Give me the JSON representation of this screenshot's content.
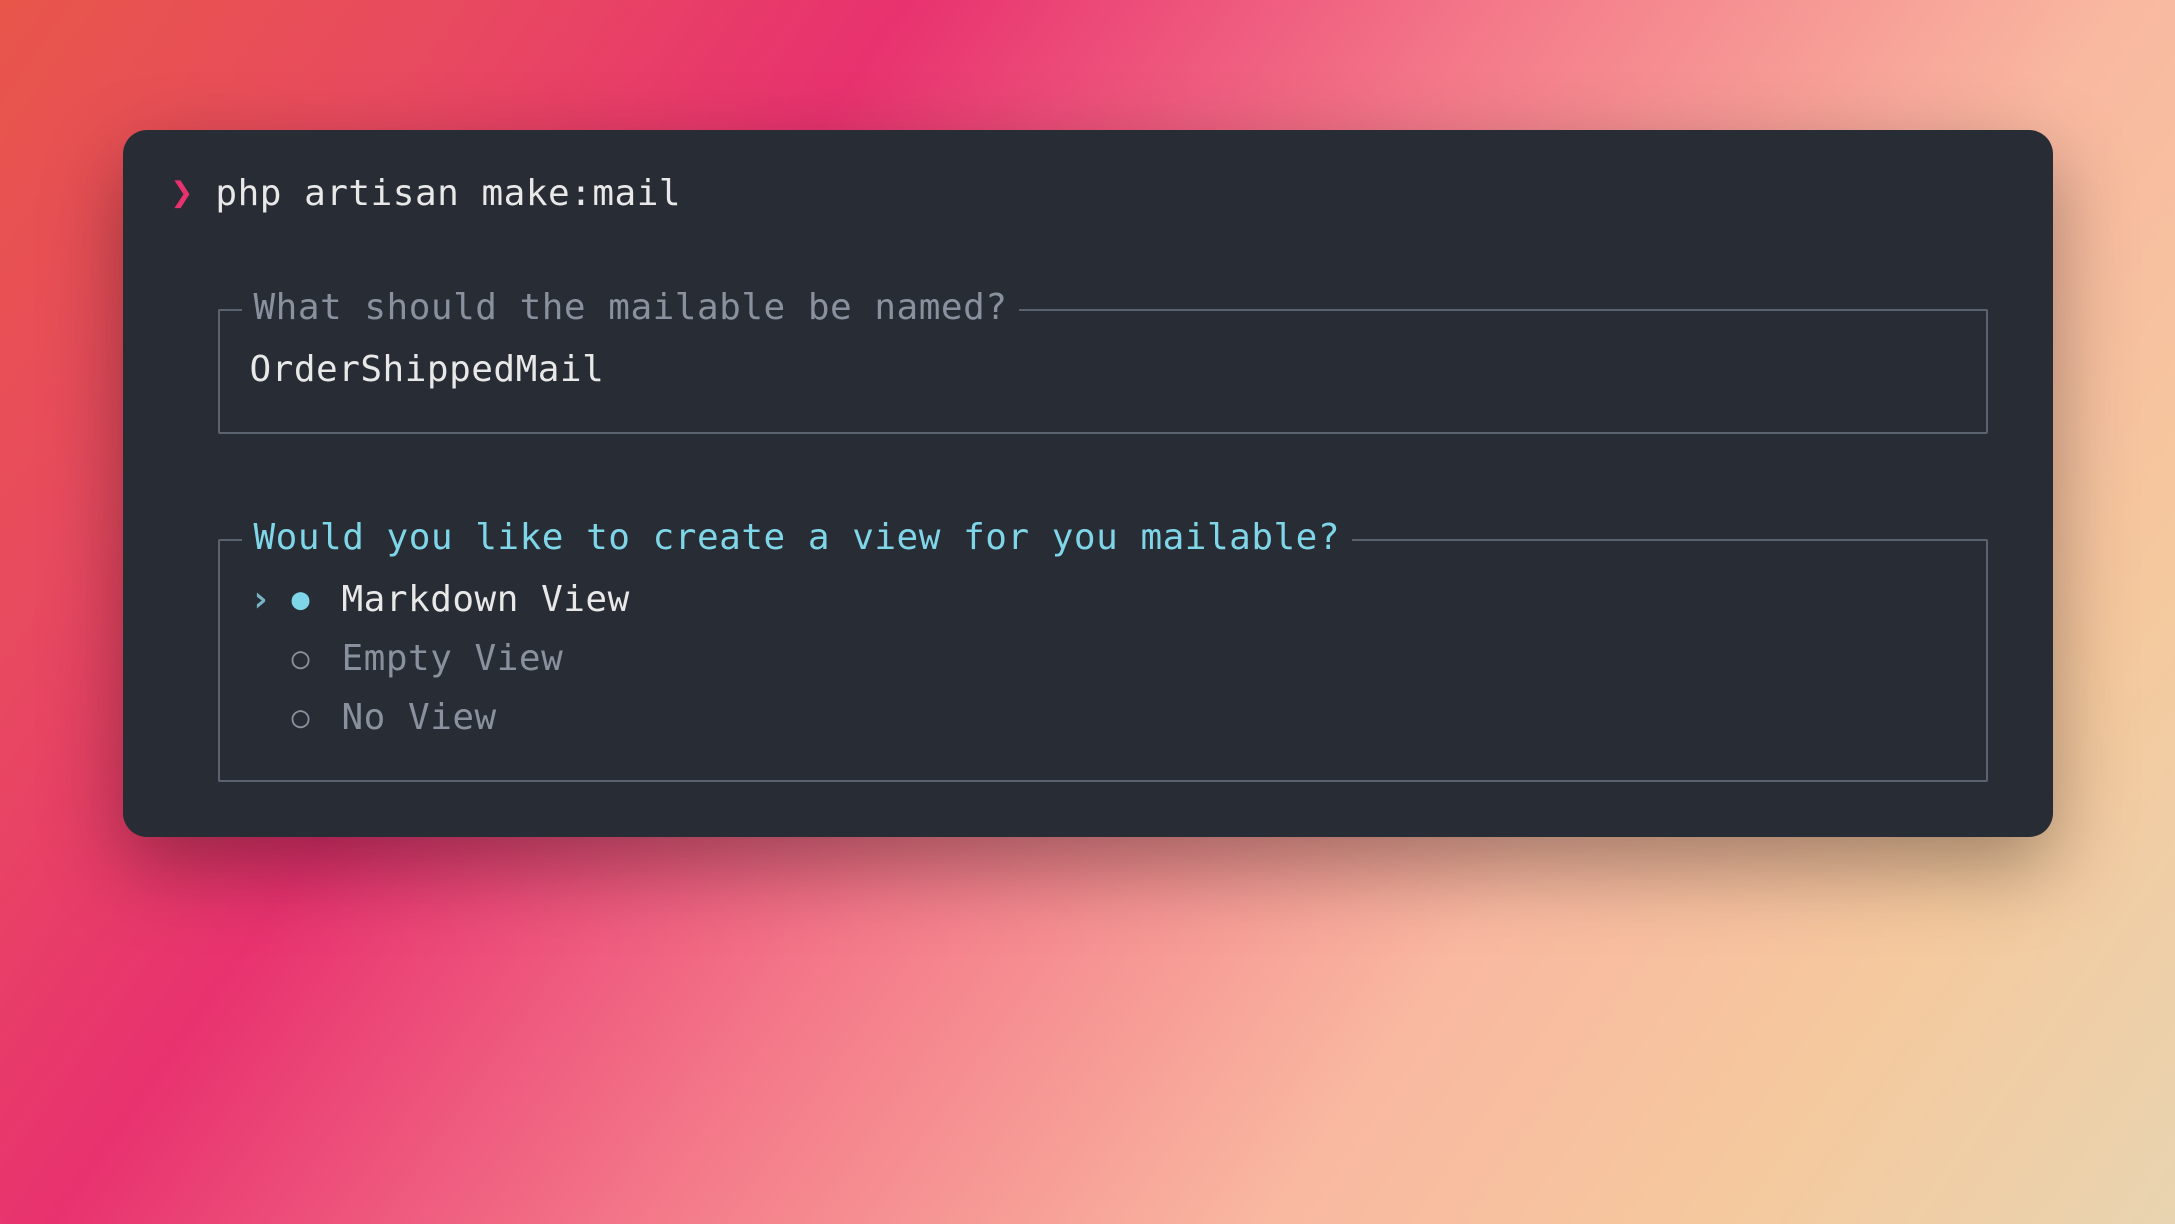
{
  "prompt_symbol": "❯",
  "command": "php artisan make:mail",
  "name_prompt": {
    "question": "What should the mailable be named?",
    "value": "OrderShippedMail"
  },
  "view_prompt": {
    "question": "Would you like to create a view for you mailable?",
    "selected_marker": "›",
    "options": [
      {
        "label": "Markdown View",
        "selected": true
      },
      {
        "label": "Empty View",
        "selected": false
      },
      {
        "label": "No View",
        "selected": false
      }
    ]
  }
}
